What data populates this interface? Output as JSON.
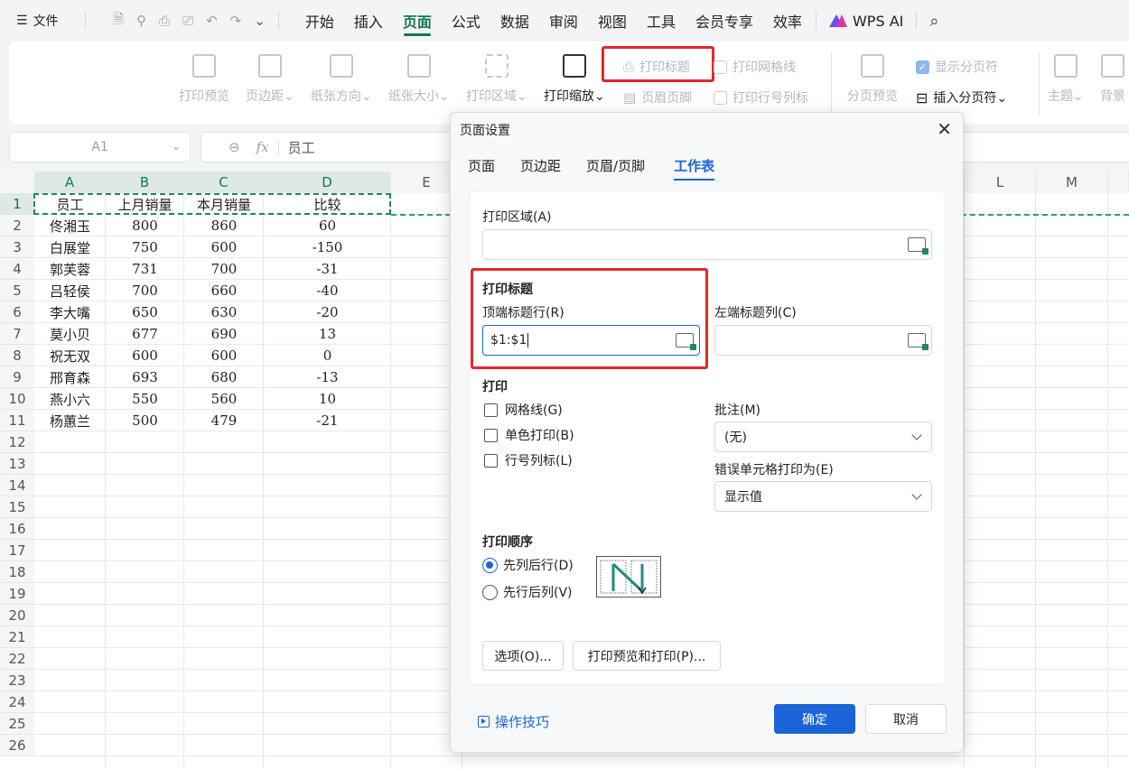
{
  "menubar": {
    "file_label": "文件",
    "tabs": [
      "开始",
      "插入",
      "页面",
      "公式",
      "数据",
      "审阅",
      "视图",
      "工具",
      "会员专享",
      "效率"
    ],
    "active_tab": "页面",
    "ai_label": "WPS AI"
  },
  "ribbon": {
    "print_preview": "打印预览",
    "margins": "页边距",
    "orientation": "纸张方向",
    "paper_size": "纸张大小",
    "print_area": "打印区域",
    "print_scale": "打印缩放",
    "print_titles": "打印标题",
    "header_footer": "页眉页脚",
    "print_gridlines": "打印网格线",
    "print_row_col_headers": "打印行号列标",
    "page_break_preview": "分页预览",
    "show_page_breaks": "显示分页符",
    "insert_page_break": "插入分页符",
    "theme": "主题",
    "background": "背景"
  },
  "formula_bar": {
    "cell_ref": "A1",
    "fx": "fx",
    "value": "员工"
  },
  "grid": {
    "columns": [
      "A",
      "B",
      "C",
      "D",
      "E",
      "L",
      "M"
    ],
    "rows": [
      "1",
      "2",
      "3",
      "4",
      "5",
      "6",
      "7",
      "8",
      "9",
      "10",
      "11",
      "12",
      "13",
      "14",
      "15",
      "16",
      "17",
      "18",
      "19",
      "20",
      "21",
      "22",
      "23",
      "24",
      "25",
      "26"
    ],
    "data": [
      [
        "员工",
        "上月销量",
        "本月销量",
        "比较"
      ],
      [
        "佟湘玉",
        "800",
        "860",
        "60"
      ],
      [
        "白展堂",
        "750",
        "600",
        "-150"
      ],
      [
        "郭芙蓉",
        "731",
        "700",
        "-31"
      ],
      [
        "吕轻侯",
        "700",
        "660",
        "-40"
      ],
      [
        "李大嘴",
        "650",
        "630",
        "-20"
      ],
      [
        "莫小贝",
        "677",
        "690",
        "13"
      ],
      [
        "祝无双",
        "600",
        "600",
        "0"
      ],
      [
        "邢育森",
        "693",
        "680",
        "-13"
      ],
      [
        "燕小六",
        "550",
        "560",
        "10"
      ],
      [
        "杨蕙兰",
        "500",
        "479",
        "-21"
      ]
    ]
  },
  "dialog": {
    "title": "页面设置",
    "tabs": [
      "页面",
      "页边距",
      "页眉/页脚",
      "工作表"
    ],
    "active_tab": "工作表",
    "print_area_label": "打印区域(A)",
    "print_titles_heading": "打印标题",
    "top_rows_label": "顶端标题行(R)",
    "top_rows_value": "$1:$1",
    "left_cols_label": "左端标题列(C)",
    "print_heading": "打印",
    "gridlines": "网格线(G)",
    "mono": "单色打印(B)",
    "row_col": "行号列标(L)",
    "comments_label": "批注(M)",
    "comments_value": "(无)",
    "errors_label": "错误单元格打印为(E)",
    "errors_value": "显示值",
    "order_heading": "打印顺序",
    "order_down_over": "先列后行(D)",
    "order_over_down": "先行后列(V)",
    "options_btn": "选项(O)...",
    "preview_btn": "打印预览和打印(P)...",
    "tips": "操作技巧",
    "ok": "确定",
    "cancel": "取消"
  },
  "colors": {
    "accent_green": "#0f7a4c",
    "accent_blue": "#1b64d8",
    "highlight_red": "#e5262b"
  }
}
